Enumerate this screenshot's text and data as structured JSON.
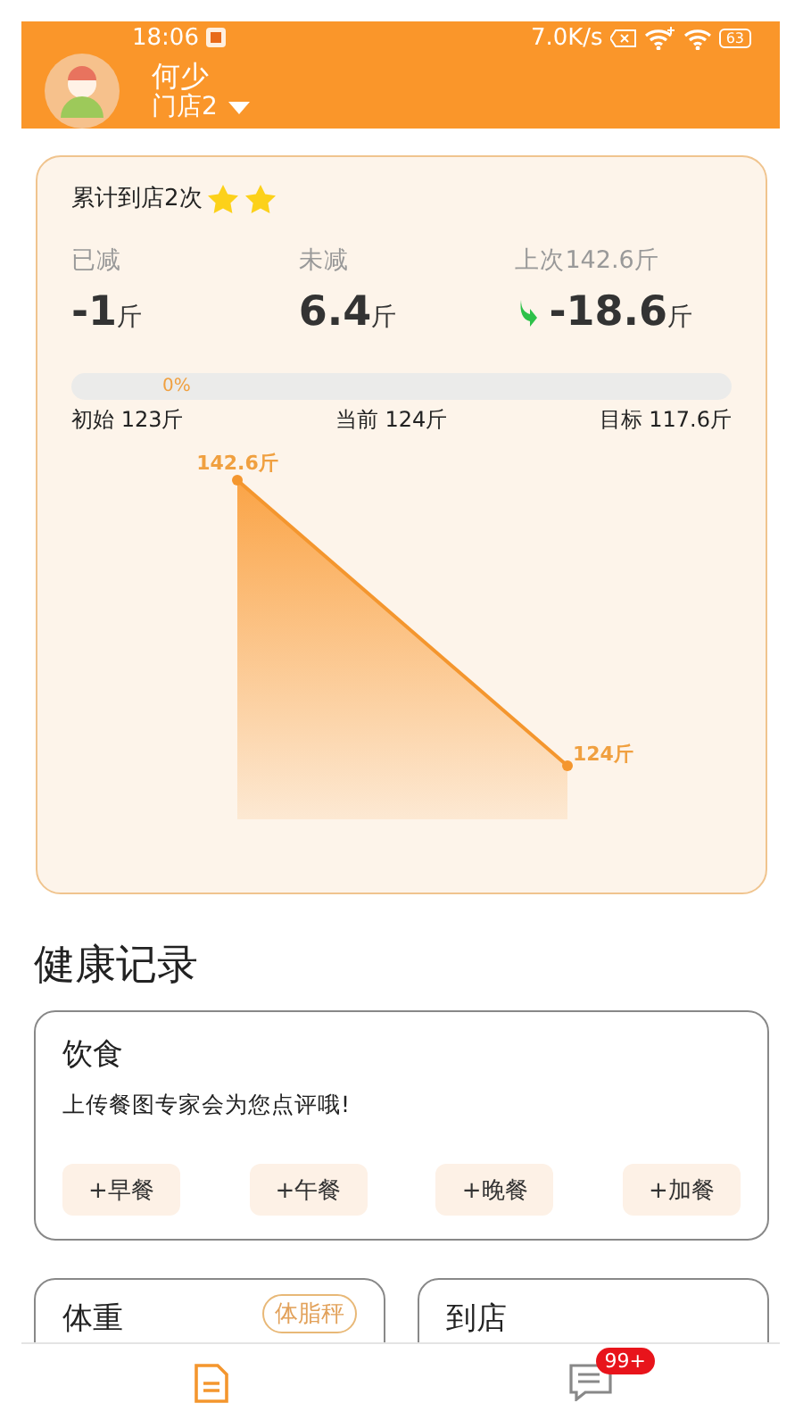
{
  "status_bar": {
    "time": "18:06",
    "speed": "7.0K/s",
    "battery": "63"
  },
  "user": {
    "name": "何少",
    "store": "门店2"
  },
  "summary": {
    "visits": "累计到店2次",
    "awards": [
      {
        "kind": "star"
      },
      {
        "kind": "star"
      }
    ],
    "stats": [
      {
        "label": "已减",
        "value": "-1",
        "unit": "斤",
        "decrease": false
      },
      {
        "label": "未减",
        "value": "6.4",
        "unit": "斤",
        "decrease": false
      },
      {
        "label": "上次142.6斤",
        "value": "-18.6",
        "unit": "斤",
        "decrease": true
      }
    ],
    "progress": {
      "level": 0,
      "reading": "0%"
    },
    "scale": [
      "初始 123斤",
      "当前 124斤",
      "目标 117.6斤"
    ],
    "trend_labels": [
      "142.6斤",
      "124斤"
    ]
  },
  "section_title": "健康记录",
  "diet": {
    "title": "饮食",
    "hint": "上传餐图专家会为您点评哦!",
    "buttons": [
      "+早餐",
      "+午餐",
      "+晚餐",
      "+加餐"
    ]
  },
  "cards": [
    {
      "title": "体重",
      "tag": "体脂秤"
    },
    {
      "title": "到店"
    }
  ],
  "tab_bar": [
    {
      "kind": "records",
      "selected": true
    },
    {
      "kind": "messages",
      "selected": false,
      "badge": "99+"
    }
  ]
}
